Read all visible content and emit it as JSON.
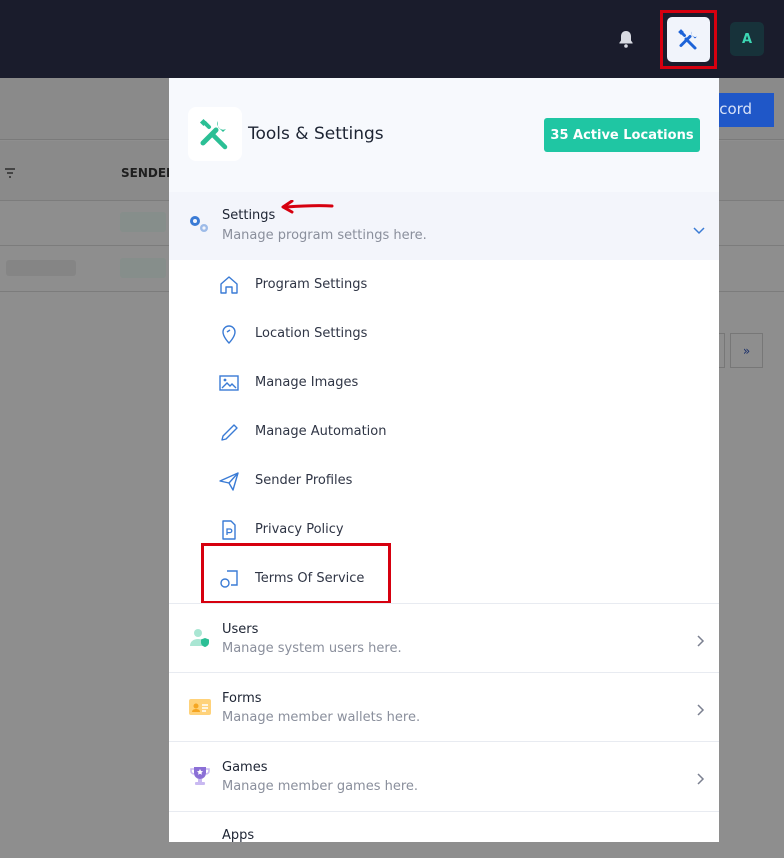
{
  "topbar": {
    "avatar_letter": "A",
    "icons": [
      "bell-icon",
      "tools-icon"
    ]
  },
  "background": {
    "record_label": "ecord",
    "sender_col": "SENDER",
    "pagination_next": "»"
  },
  "panel": {
    "title": "Tools & Settings",
    "locations_label": "35 Active Locations",
    "settings": {
      "title": "Settings",
      "subtitle": "Manage program settings here.",
      "items": [
        {
          "label": "Program Settings",
          "icon": "home-icon"
        },
        {
          "label": "Location Settings",
          "icon": "location-pin-icon"
        },
        {
          "label": "Manage Images",
          "icon": "image-icon"
        },
        {
          "label": "Manage Automation",
          "icon": "pencil-icon"
        },
        {
          "label": "Sender Profiles",
          "icon": "paper-plane-icon"
        },
        {
          "label": "Privacy Policy",
          "icon": "document-p-icon"
        },
        {
          "label": "Terms Of Service",
          "icon": "shapes-icon"
        }
      ]
    },
    "groups": [
      {
        "title": "Users",
        "subtitle": "Manage system users here.",
        "icon": "user-shield-icon"
      },
      {
        "title": "Forms",
        "subtitle": "Manage member wallets here.",
        "icon": "id-card-icon"
      },
      {
        "title": "Games",
        "subtitle": "Manage member games here.",
        "icon": "trophy-icon"
      },
      {
        "title": "Apps",
        "subtitle": "",
        "icon": "apps-icon"
      }
    ]
  },
  "colors": {
    "accent_teal": "#1fc6a3",
    "topbar": "#1a1c2c",
    "highlight_red": "#d6000f",
    "icon_blue": "#3a7bd5"
  }
}
